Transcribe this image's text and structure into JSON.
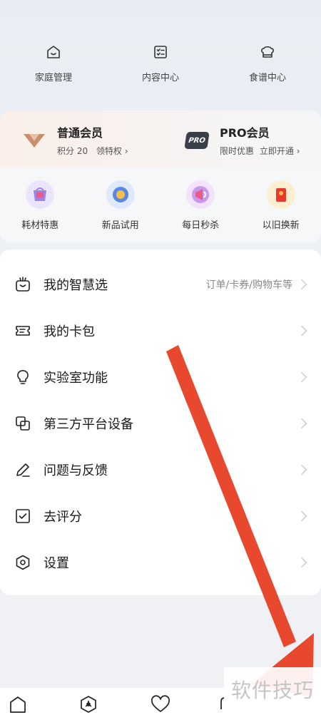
{
  "top_actions": [
    {
      "label": "家庭管理",
      "icon": "home-icon"
    },
    {
      "label": "内容中心",
      "icon": "checklist-icon"
    },
    {
      "label": "食谱中心",
      "icon": "chef-hat-icon"
    }
  ],
  "membership": {
    "normal": {
      "title": "普通会员",
      "points": "积分 20",
      "link": "领特权",
      "chevron": "›"
    },
    "pro": {
      "title": "PRO会员",
      "badge": "PRO",
      "promo": "限时优惠",
      "link": "立即开通",
      "chevron": "›"
    }
  },
  "perks": [
    {
      "label": "耗材特惠",
      "icon": "consumables-icon",
      "color": "#9a82e8"
    },
    {
      "label": "新品试用",
      "icon": "new-product-icon",
      "color": "#5a86e6"
    },
    {
      "label": "每日秒杀",
      "icon": "flash-sale-icon",
      "color": "#a772e6"
    },
    {
      "label": "以旧换新",
      "icon": "trade-in-icon",
      "color": "#f0b93a"
    }
  ],
  "menu": [
    {
      "label": "我的智慧选",
      "icon": "shopping-bag-icon",
      "extra": "订单/卡券/购物车等"
    },
    {
      "label": "我的卡包",
      "icon": "card-wallet-icon",
      "extra": ""
    },
    {
      "label": "实验室功能",
      "icon": "lightbulb-icon",
      "extra": ""
    },
    {
      "label": "第三方平台设备",
      "icon": "link-devices-icon",
      "extra": ""
    },
    {
      "label": "问题与反馈",
      "icon": "pencil-icon",
      "extra": ""
    },
    {
      "label": "去评分",
      "icon": "checkbox-icon",
      "extra": ""
    },
    {
      "label": "设置",
      "icon": "hexagon-settings-icon",
      "extra": ""
    }
  ],
  "bottom_nav": [
    {
      "icon": "home-icon"
    },
    {
      "icon": "smart-hexagon-icon"
    },
    {
      "icon": "heart-icon"
    }
  ],
  "watermark": "软件技巧",
  "colors": {
    "arrow": "#e8492e",
    "accent_pro": "#3a3d4a",
    "chevron": "#b7b9bd"
  }
}
